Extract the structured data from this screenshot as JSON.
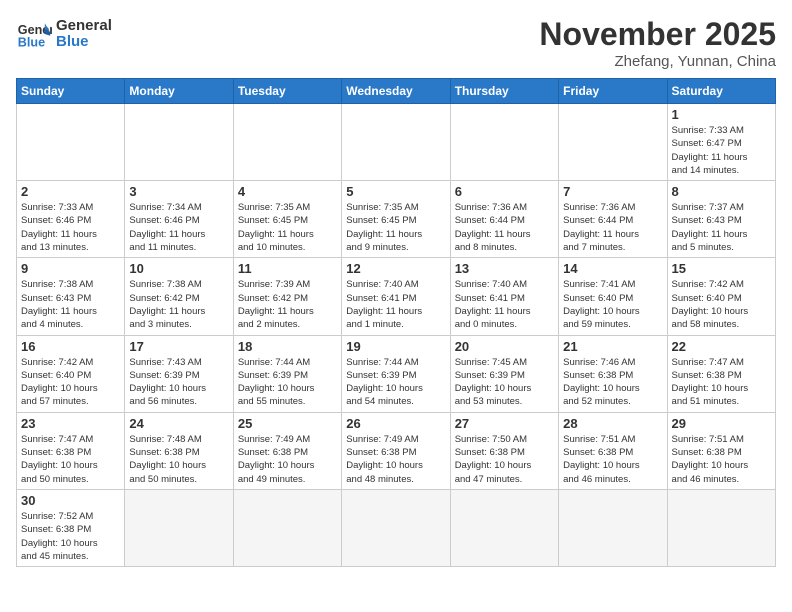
{
  "logo": {
    "general": "General",
    "blue": "Blue"
  },
  "header": {
    "month": "November 2025",
    "location": "Zhefang, Yunnan, China"
  },
  "weekdays": [
    "Sunday",
    "Monday",
    "Tuesday",
    "Wednesday",
    "Thursday",
    "Friday",
    "Saturday"
  ],
  "weeks": [
    [
      {
        "day": "",
        "info": ""
      },
      {
        "day": "",
        "info": ""
      },
      {
        "day": "",
        "info": ""
      },
      {
        "day": "",
        "info": ""
      },
      {
        "day": "",
        "info": ""
      },
      {
        "day": "",
        "info": ""
      },
      {
        "day": "1",
        "info": "Sunrise: 7:33 AM\nSunset: 6:47 PM\nDaylight: 11 hours\nand 14 minutes."
      }
    ],
    [
      {
        "day": "2",
        "info": "Sunrise: 7:33 AM\nSunset: 6:46 PM\nDaylight: 11 hours\nand 13 minutes."
      },
      {
        "day": "3",
        "info": "Sunrise: 7:34 AM\nSunset: 6:46 PM\nDaylight: 11 hours\nand 11 minutes."
      },
      {
        "day": "4",
        "info": "Sunrise: 7:35 AM\nSunset: 6:45 PM\nDaylight: 11 hours\nand 10 minutes."
      },
      {
        "day": "5",
        "info": "Sunrise: 7:35 AM\nSunset: 6:45 PM\nDaylight: 11 hours\nand 9 minutes."
      },
      {
        "day": "6",
        "info": "Sunrise: 7:36 AM\nSunset: 6:44 PM\nDaylight: 11 hours\nand 8 minutes."
      },
      {
        "day": "7",
        "info": "Sunrise: 7:36 AM\nSunset: 6:44 PM\nDaylight: 11 hours\nand 7 minutes."
      },
      {
        "day": "8",
        "info": "Sunrise: 7:37 AM\nSunset: 6:43 PM\nDaylight: 11 hours\nand 5 minutes."
      }
    ],
    [
      {
        "day": "9",
        "info": "Sunrise: 7:38 AM\nSunset: 6:43 PM\nDaylight: 11 hours\nand 4 minutes."
      },
      {
        "day": "10",
        "info": "Sunrise: 7:38 AM\nSunset: 6:42 PM\nDaylight: 11 hours\nand 3 minutes."
      },
      {
        "day": "11",
        "info": "Sunrise: 7:39 AM\nSunset: 6:42 PM\nDaylight: 11 hours\nand 2 minutes."
      },
      {
        "day": "12",
        "info": "Sunrise: 7:40 AM\nSunset: 6:41 PM\nDaylight: 11 hours\nand 1 minute."
      },
      {
        "day": "13",
        "info": "Sunrise: 7:40 AM\nSunset: 6:41 PM\nDaylight: 11 hours\nand 0 minutes."
      },
      {
        "day": "14",
        "info": "Sunrise: 7:41 AM\nSunset: 6:40 PM\nDaylight: 10 hours\nand 59 minutes."
      },
      {
        "day": "15",
        "info": "Sunrise: 7:42 AM\nSunset: 6:40 PM\nDaylight: 10 hours\nand 58 minutes."
      }
    ],
    [
      {
        "day": "16",
        "info": "Sunrise: 7:42 AM\nSunset: 6:40 PM\nDaylight: 10 hours\nand 57 minutes."
      },
      {
        "day": "17",
        "info": "Sunrise: 7:43 AM\nSunset: 6:39 PM\nDaylight: 10 hours\nand 56 minutes."
      },
      {
        "day": "18",
        "info": "Sunrise: 7:44 AM\nSunset: 6:39 PM\nDaylight: 10 hours\nand 55 minutes."
      },
      {
        "day": "19",
        "info": "Sunrise: 7:44 AM\nSunset: 6:39 PM\nDaylight: 10 hours\nand 54 minutes."
      },
      {
        "day": "20",
        "info": "Sunrise: 7:45 AM\nSunset: 6:39 PM\nDaylight: 10 hours\nand 53 minutes."
      },
      {
        "day": "21",
        "info": "Sunrise: 7:46 AM\nSunset: 6:38 PM\nDaylight: 10 hours\nand 52 minutes."
      },
      {
        "day": "22",
        "info": "Sunrise: 7:47 AM\nSunset: 6:38 PM\nDaylight: 10 hours\nand 51 minutes."
      }
    ],
    [
      {
        "day": "23",
        "info": "Sunrise: 7:47 AM\nSunset: 6:38 PM\nDaylight: 10 hours\nand 50 minutes."
      },
      {
        "day": "24",
        "info": "Sunrise: 7:48 AM\nSunset: 6:38 PM\nDaylight: 10 hours\nand 50 minutes."
      },
      {
        "day": "25",
        "info": "Sunrise: 7:49 AM\nSunset: 6:38 PM\nDaylight: 10 hours\nand 49 minutes."
      },
      {
        "day": "26",
        "info": "Sunrise: 7:49 AM\nSunset: 6:38 PM\nDaylight: 10 hours\nand 48 minutes."
      },
      {
        "day": "27",
        "info": "Sunrise: 7:50 AM\nSunset: 6:38 PM\nDaylight: 10 hours\nand 47 minutes."
      },
      {
        "day": "28",
        "info": "Sunrise: 7:51 AM\nSunset: 6:38 PM\nDaylight: 10 hours\nand 46 minutes."
      },
      {
        "day": "29",
        "info": "Sunrise: 7:51 AM\nSunset: 6:38 PM\nDaylight: 10 hours\nand 46 minutes."
      }
    ],
    [
      {
        "day": "30",
        "info": "Sunrise: 7:52 AM\nSunset: 6:38 PM\nDaylight: 10 hours\nand 45 minutes."
      },
      {
        "day": "",
        "info": ""
      },
      {
        "day": "",
        "info": ""
      },
      {
        "day": "",
        "info": ""
      },
      {
        "day": "",
        "info": ""
      },
      {
        "day": "",
        "info": ""
      },
      {
        "day": "",
        "info": ""
      }
    ]
  ]
}
